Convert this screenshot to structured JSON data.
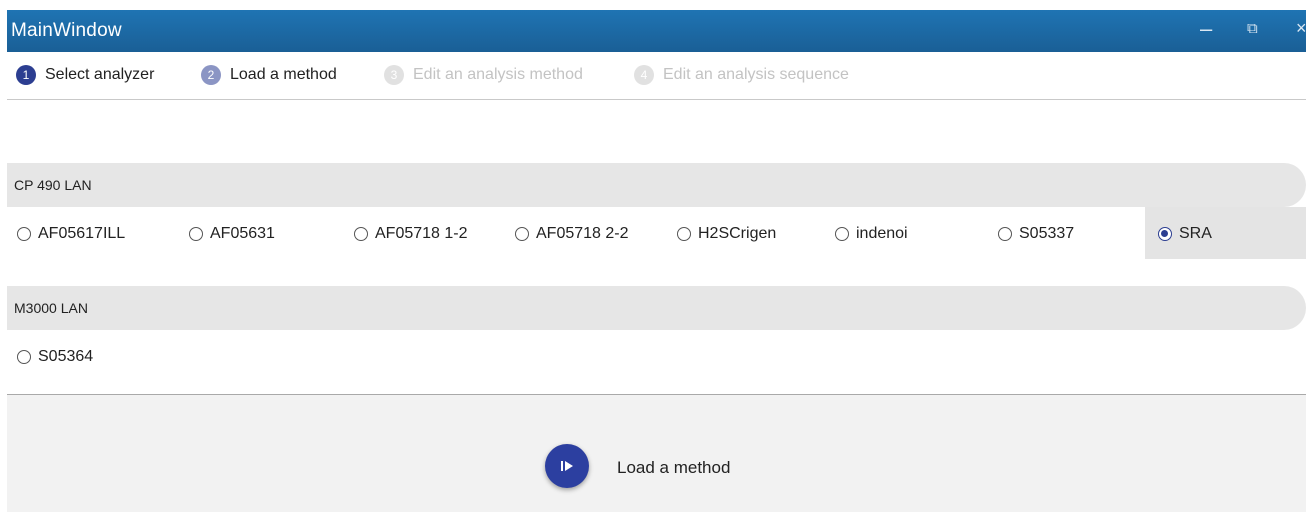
{
  "window": {
    "title": "MainWindow",
    "controls": {
      "minimize": "–",
      "restore": "⧉",
      "close": "×"
    }
  },
  "stepper": {
    "steps": [
      {
        "number": "1",
        "label": "Select analyzer",
        "state": "completed"
      },
      {
        "number": "2",
        "label": "Load a method",
        "state": "active"
      },
      {
        "number": "3",
        "label": "Edit an analysis method",
        "state": "disabled"
      },
      {
        "number": "4",
        "label": "Edit an analysis sequence",
        "state": "disabled"
      }
    ]
  },
  "groups": [
    {
      "name": "CP 490 LAN",
      "options": [
        {
          "label": "AF05617ILL",
          "selected": false
        },
        {
          "label": "AF05631",
          "selected": false
        },
        {
          "label": "AF05718 1-2",
          "selected": false
        },
        {
          "label": "AF05718 2-2",
          "selected": false
        },
        {
          "label": "H2SCrigen",
          "selected": false
        },
        {
          "label": "indenoi",
          "selected": false
        },
        {
          "label": "S05337",
          "selected": false
        },
        {
          "label": "SRA",
          "selected": true
        }
      ]
    },
    {
      "name": "M3000 LAN",
      "options": [
        {
          "label": "S05364",
          "selected": false
        }
      ]
    }
  ],
  "footer": {
    "load_button_icon": "play-step-icon",
    "load_label": "Load a method"
  },
  "colors": {
    "titlebar": "#1a66a3",
    "accent": "#2c3e91",
    "step_active": "#8b95c4",
    "step_disabled": "#e1e1e1"
  }
}
